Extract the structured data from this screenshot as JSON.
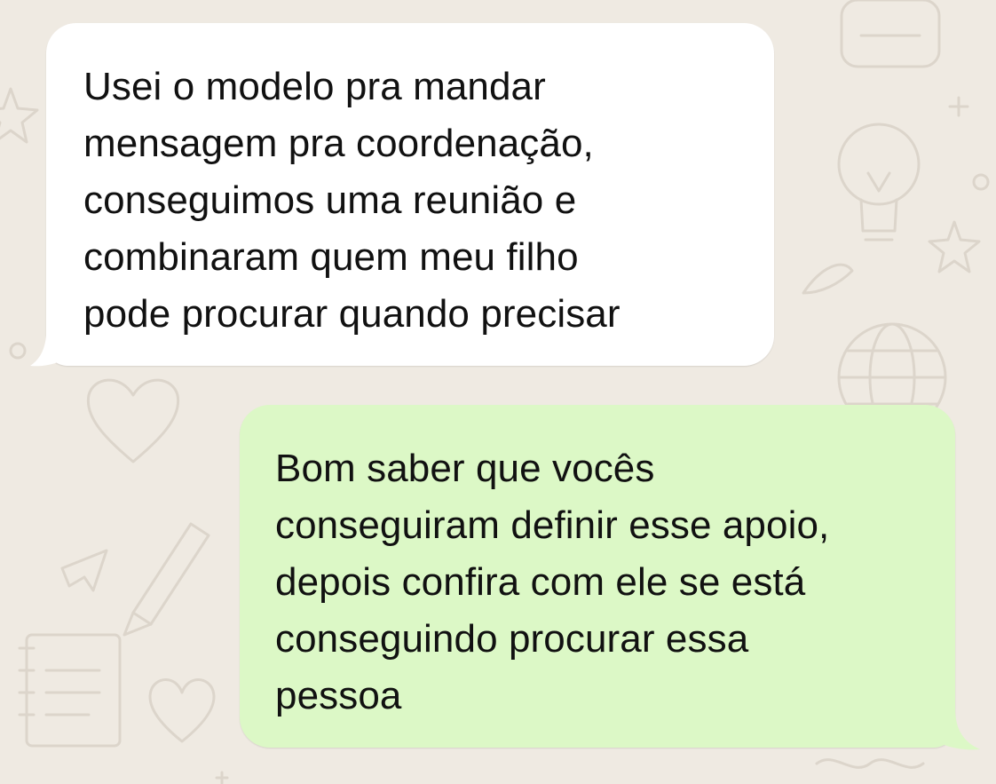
{
  "chat": {
    "wallpaper_color": "#efeae2",
    "wallpaper_icons": [
      "heart-icon",
      "star-icon",
      "lightbulb-icon",
      "globe-icon",
      "pencil-icon",
      "notebook-icon",
      "airplane-icon",
      "backpack-icon"
    ],
    "messages": [
      {
        "direction": "incoming",
        "bubble_color": "#ffffff",
        "lines": [
          "Usei o modelo pra mandar",
          "mensagem pra coordenação,",
          "conseguimos uma reunião e",
          "combinaram quem meu filho",
          "pode procurar quando precisar"
        ]
      },
      {
        "direction": "outgoing",
        "bubble_color": "#dcf8c6",
        "lines": [
          "Bom saber que vocês",
          "conseguiram definir esse apoio,",
          "depois confira com ele se está",
          "conseguindo procurar essa",
          "pessoa"
        ]
      }
    ]
  }
}
